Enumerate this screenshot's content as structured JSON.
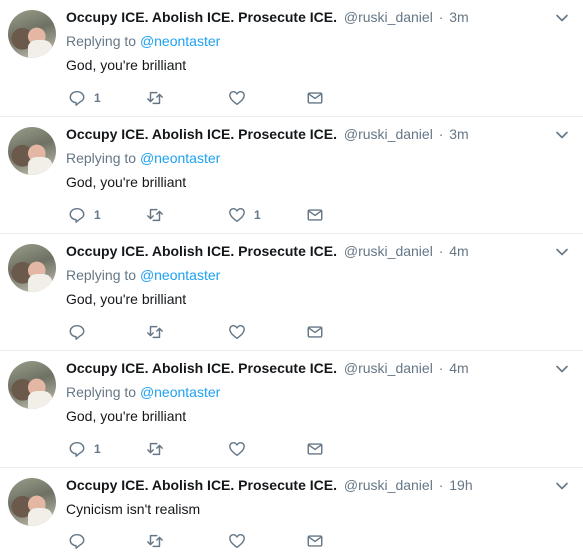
{
  "colors": {
    "text": "#14171a",
    "muted": "#657786",
    "link": "#1da1f2",
    "divider": "#e6ecf0"
  },
  "icons": [
    "reply-icon",
    "retweet-icon",
    "like-icon",
    "direct-message-icon",
    "chevron-down-icon"
  ],
  "tweets": [
    {
      "name": "Occupy ICE. Abolish ICE. Prosecute ICE.",
      "handle": "@ruski_daniel",
      "separator": "·",
      "time": "3m",
      "replying_label": "Replying to",
      "replying_to": "@neontaster",
      "text": "God, you're brilliant",
      "reply_count": "1",
      "retweet_count": "",
      "like_count": ""
    },
    {
      "name": "Occupy ICE. Abolish ICE. Prosecute ICE.",
      "handle": "@ruski_daniel",
      "separator": "·",
      "time": "3m",
      "replying_label": "Replying to",
      "replying_to": "@neontaster",
      "text": "God, you're brilliant",
      "reply_count": "1",
      "retweet_count": "",
      "like_count": "1"
    },
    {
      "name": "Occupy ICE. Abolish ICE. Prosecute ICE.",
      "handle": "@ruski_daniel",
      "separator": "·",
      "time": "4m",
      "replying_label": "Replying to",
      "replying_to": "@neontaster",
      "text": "God, you're brilliant",
      "reply_count": "",
      "retweet_count": "",
      "like_count": ""
    },
    {
      "name": "Occupy ICE. Abolish ICE. Prosecute ICE.",
      "handle": "@ruski_daniel",
      "separator": "·",
      "time": "4m",
      "replying_label": "Replying to",
      "replying_to": "@neontaster",
      "text": "God, you're brilliant",
      "reply_count": "1",
      "retweet_count": "",
      "like_count": ""
    },
    {
      "name": "Occupy ICE. Abolish ICE. Prosecute ICE.",
      "handle": "@ruski_daniel",
      "separator": "·",
      "time": "19h",
      "text": "Cynicism isn't realism",
      "reply_count": "",
      "retweet_count": "",
      "like_count": ""
    }
  ]
}
